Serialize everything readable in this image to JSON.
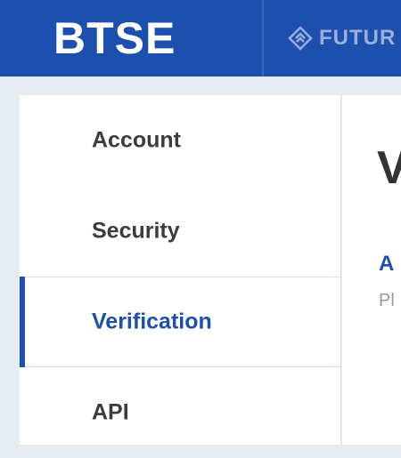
{
  "header": {
    "logo_text": "BTSE",
    "futures_label": "FUTUR",
    "futures_icon": "futures-diamond-icon",
    "background": "#1d4fae"
  },
  "sidebar": {
    "items": [
      {
        "label": "Account",
        "active": false
      },
      {
        "label": "Security",
        "active": false
      },
      {
        "label": "Verification",
        "active": true
      },
      {
        "label": "API",
        "active": false
      }
    ],
    "active_color": "#1d4fae"
  },
  "main": {
    "title": "V",
    "link_text": "A",
    "subtext": "Pl"
  }
}
